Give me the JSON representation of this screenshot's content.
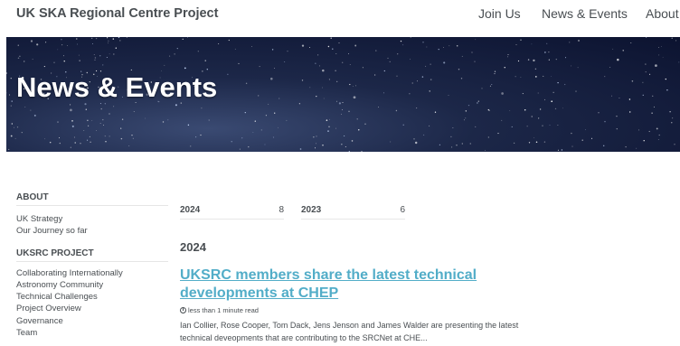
{
  "header": {
    "site_title": "UK SKA Regional Centre Project",
    "nav": [
      {
        "label": "Join Us"
      },
      {
        "label": "News & Events"
      },
      {
        "label": "About"
      }
    ]
  },
  "hero": {
    "title": "News & Events"
  },
  "sidebar": {
    "sections": [
      {
        "heading": "ABOUT",
        "items": [
          "UK Strategy",
          "Our Journey so far"
        ]
      },
      {
        "heading": "UKSRC PROJECT",
        "items": [
          "Collaborating Internationally",
          "Astronomy Community",
          "Technical Challenges",
          "Project Overview",
          "Governance",
          "Team"
        ]
      }
    ]
  },
  "year_tabs": [
    {
      "year": "2024",
      "count": "8"
    },
    {
      "year": "2023",
      "count": "6"
    }
  ],
  "main": {
    "section_year": "2024",
    "post": {
      "title": "UKSRC members share the latest technical developments at CHEP",
      "read_time": "less than 1 minute read",
      "excerpt": "Ian Collier, Rose Cooper, Tom Dack, Jens Jenson and James Walder are presenting the latest technical deveopments that are contributing to the SRCNet at CHE..."
    }
  },
  "colors": {
    "link": "#52adc8",
    "text": "#494e52"
  }
}
